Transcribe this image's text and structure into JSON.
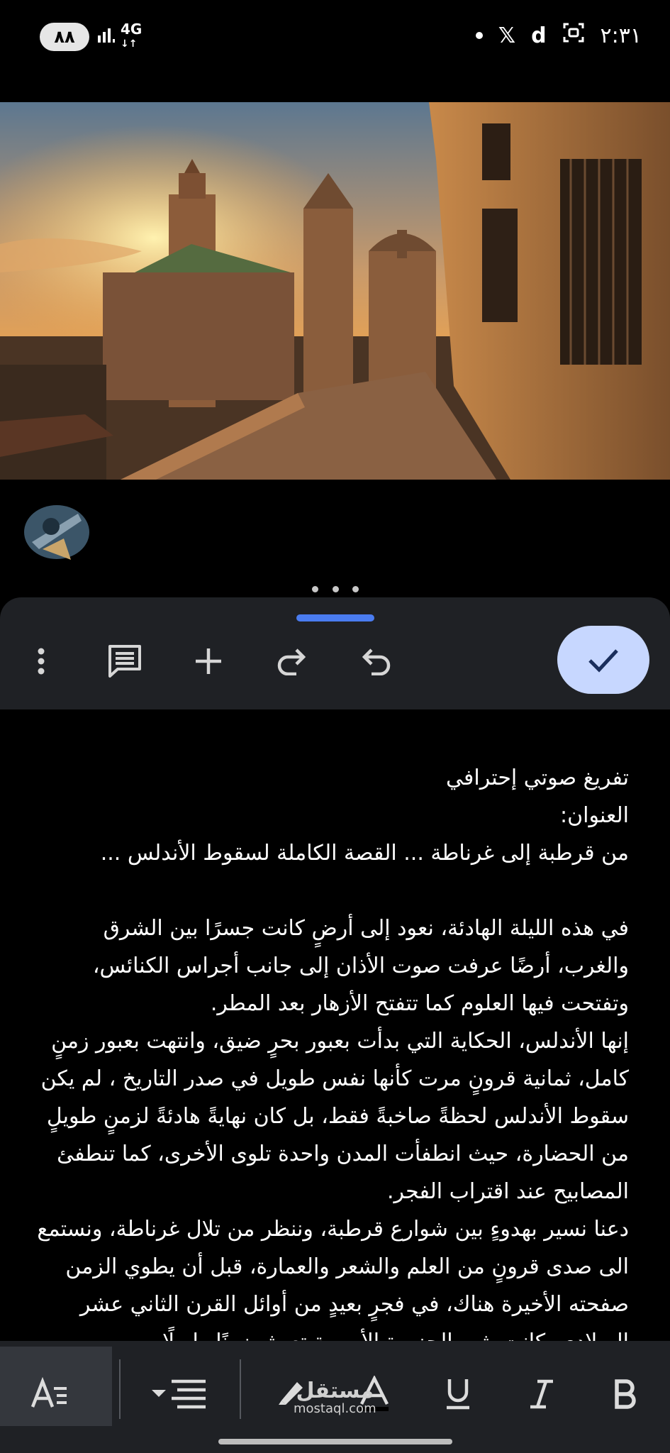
{
  "status_bar": {
    "battery": "٨٨",
    "network": "4G",
    "time": "٢:٣١",
    "icons": [
      "dot",
      "x-icon",
      "d-app-icon",
      "screenshot-icon"
    ]
  },
  "editor_toolbar": {
    "icons": [
      "more-vert-icon",
      "comment-icon",
      "add-icon",
      "redo-icon",
      "undo-icon",
      "check-icon"
    ]
  },
  "document": {
    "title_line": "تفريغ صوتي إحترافي",
    "heading_label": "العنوان:",
    "heading": "من قرطبة إلى غرناطة ... القصة الكاملة لسقوط الأندلس ...",
    "paragraphs": [
      "في هذه الليلة الهادئة، نعود إلى أرضٍ كانت جسرًا بين الشرق والغرب، أرضًا عرفت صوت الأذان إلى جانب أجراس الكنائس، وتفتحت فيها العلوم كما تتفتح الأزهار بعد المطر.",
      "إنها الأندلس، الحكاية التي بدأت بعبور بحرٍ ضيق، وانتهت بعبور زمنٍ كامل، ثمانية قرونٍ مرت كأنها نفس طويل في صدر التاريخ ، لم يكن سقوط الأندلس لحظةً صاخبةً فقط، بل كان نهايةً هادئةً لزمنٍ طويلٍ من الحضارة، حيث انطفأت المدن واحدة تلوى الأخرى، كما تنطفئ المصابيح عند اقتراب الفجر.",
      "دعنا نسير بهدوءٍ بين شوارع قرطبة، وننظر من تلال غرناطة، ونستمع الى صدى قرونٍ من العلم والشعر والعمارة، قبل أن يطوي الزمن صفحته الأخيرة هناك، في فجرٍ بعيدٍ من أوائل القرن الثاني عشر الميلادي، كانت شبه الجزيرة الأيبيرية تعيش زمنًا طويلًا"
    ]
  },
  "format_bar": {
    "icons": [
      "text-format-icon",
      "align-icon",
      "highlight-icon",
      "text-color-icon",
      "underline-icon",
      "italic-icon",
      "bold-icon"
    ],
    "watermark_main": "مستقل",
    "watermark_sub": "mostaql.com"
  },
  "colors": {
    "accent": "#4a7cf0",
    "done_button": "#c7d7ff",
    "toolbar_bg": "#1f2125"
  }
}
